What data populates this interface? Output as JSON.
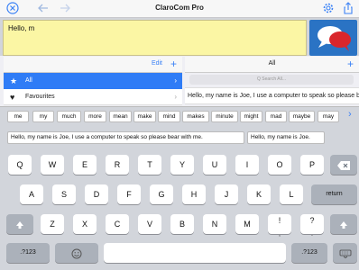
{
  "app": {
    "title": "ClaroCom Pro"
  },
  "toolbar_icons": [
    "close-circle-icon",
    "undo-icon",
    "redo-icon",
    "settings-gear-icon",
    "share-icon"
  ],
  "editor": {
    "text": "Hello, m"
  },
  "colors": {
    "accent": "#3b82f6",
    "editor_bg": "#fbf6a4",
    "speak_button_bg": "#2a73c4",
    "selected_row": "#2f7cf6"
  },
  "categories": {
    "edit_label": "Edit",
    "add_label": "+",
    "items": [
      {
        "label": "All",
        "icon": "star-icon",
        "selected": true
      },
      {
        "label": "Favourites",
        "icon": "heart-icon",
        "selected": false
      }
    ]
  },
  "phrases": {
    "header": "All",
    "add_label": "+",
    "search_placeholder": "Q  Search All...",
    "items": [
      "Hello, my name is Joe, I use a computer to speak so please bear with me."
    ]
  },
  "predictions": {
    "words": [
      "me",
      "my",
      "much",
      "more",
      "mean",
      "make",
      "mind",
      "makes",
      "minute",
      "might",
      "mad",
      "maybe",
      "may"
    ],
    "sentences": [
      "Hello, my name is Joe, I use a computer to speak so please bear with me.",
      "Hello, my name is Joe."
    ]
  },
  "keyboard": {
    "row1": [
      "Q",
      "W",
      "E",
      "R",
      "T",
      "Y",
      "U",
      "I",
      "O",
      "P"
    ],
    "row2": [
      "A",
      "S",
      "D",
      "F",
      "G",
      "H",
      "J",
      "K",
      "L"
    ],
    "row3": [
      "Z",
      "X",
      "C",
      "V",
      "B",
      "N",
      "M",
      "!",
      "?"
    ],
    "row3_sub": [
      ",",
      "."
    ],
    "return_label": "return",
    "numbers_label": ".?123",
    "backspace_icon": "backspace-icon",
    "shift_icon": "shift-arrow-icon",
    "emoji_icon": "emoji-icon",
    "hide_keyboard_icon": "keyboard-hide-icon"
  }
}
